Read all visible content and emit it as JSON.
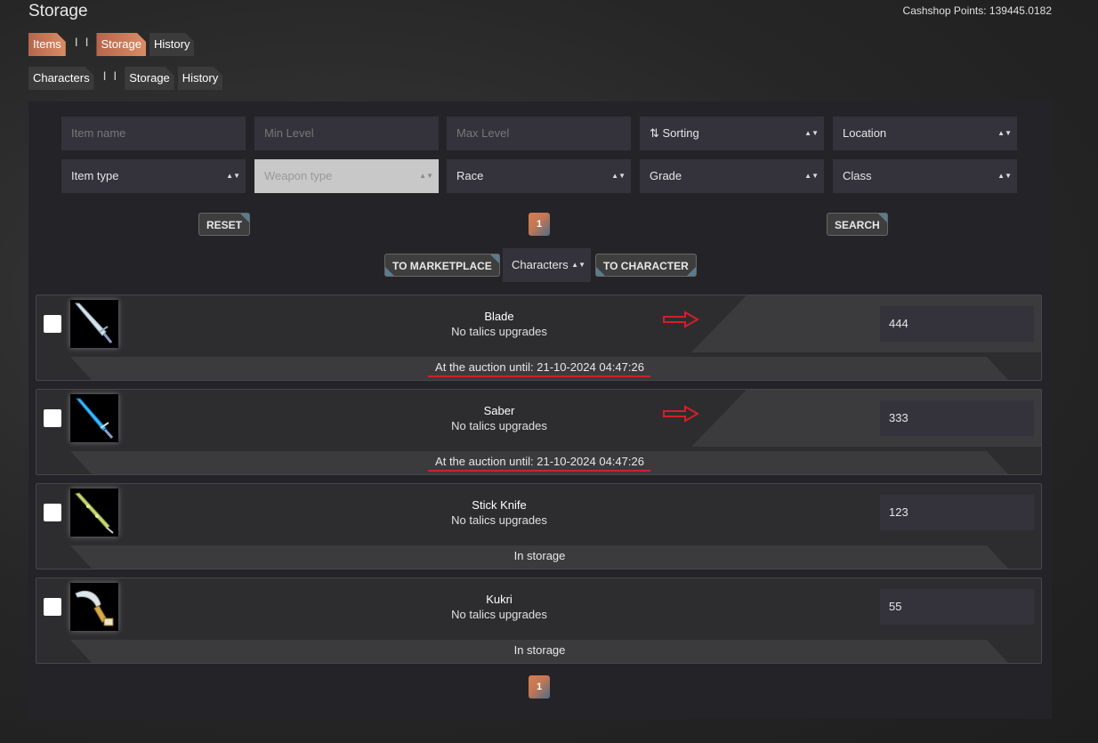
{
  "header": {
    "title": "Storage",
    "cashshop": "Cashshop Points: 139445.0182"
  },
  "nav_items": {
    "tabs": [
      "Items",
      "Storage",
      "History"
    ],
    "active": "Storage",
    "separator": "I I"
  },
  "nav_characters": {
    "tabs": [
      "Characters",
      "Storage",
      "History"
    ],
    "separator": "I I"
  },
  "filters": {
    "item_name": "Item name",
    "min_level": "Min Level",
    "max_level": "Max Level",
    "sorting": "⇅ Sorting",
    "location": "Location",
    "item_type": "Item type",
    "weapon_type": "Weapon type",
    "race": "Race",
    "grade": "Grade",
    "class": "Class",
    "select_arrows": "▲▼"
  },
  "actions": {
    "reset": "RESET",
    "search": "SEARCH",
    "page": "1",
    "to_marketplace": "TO MARKETPLACE",
    "characters_select": "Characters",
    "to_character": "TO CHARACTER"
  },
  "items": [
    {
      "name": "Blade",
      "upgrades": "No talics upgrades",
      "status": "At the auction until: 21-10-2024 04:47:26",
      "quantity": "444",
      "highlighted": true,
      "icon": "blade-icon"
    },
    {
      "name": "Saber",
      "upgrades": "No talics upgrades",
      "status": "At the auction until: 21-10-2024 04:47:26",
      "quantity": "333",
      "highlighted": true,
      "icon": "saber-icon"
    },
    {
      "name": "Stick Knife",
      "upgrades": "No talics upgrades",
      "status": "In storage",
      "quantity": "123",
      "highlighted": false,
      "icon": "stick-knife-icon"
    },
    {
      "name": "Kukri",
      "upgrades": "No talics upgrades",
      "status": "In storage",
      "quantity": "55",
      "highlighted": false,
      "icon": "kukri-icon"
    }
  ],
  "pagination_bottom": "1",
  "colors": {
    "accent_tab": "#d98c65",
    "annotation_red": "#d0202a",
    "panel_bg": "#242428"
  }
}
